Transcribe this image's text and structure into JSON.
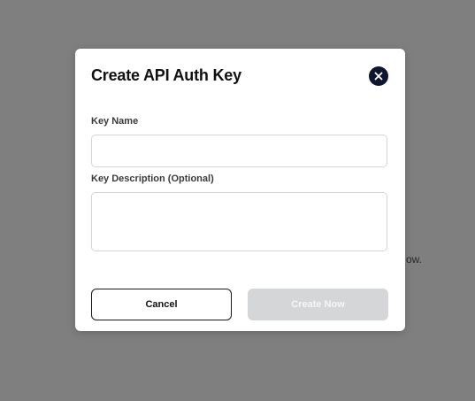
{
  "background": {
    "partial_text": "ow."
  },
  "modal": {
    "title": "Create API Auth Key",
    "close_icon": "close-icon",
    "key_name": {
      "label": "Key Name",
      "value": "",
      "placeholder": ""
    },
    "key_description": {
      "label": "Key Description (Optional)",
      "value": "",
      "placeholder": ""
    },
    "cancel_label": "Cancel",
    "create_label": "Create Now",
    "create_disabled": true
  },
  "colors": {
    "overlay": "#7f7f7f",
    "close_button": "#0f1630",
    "disabled_button": "#d5d6d8"
  }
}
